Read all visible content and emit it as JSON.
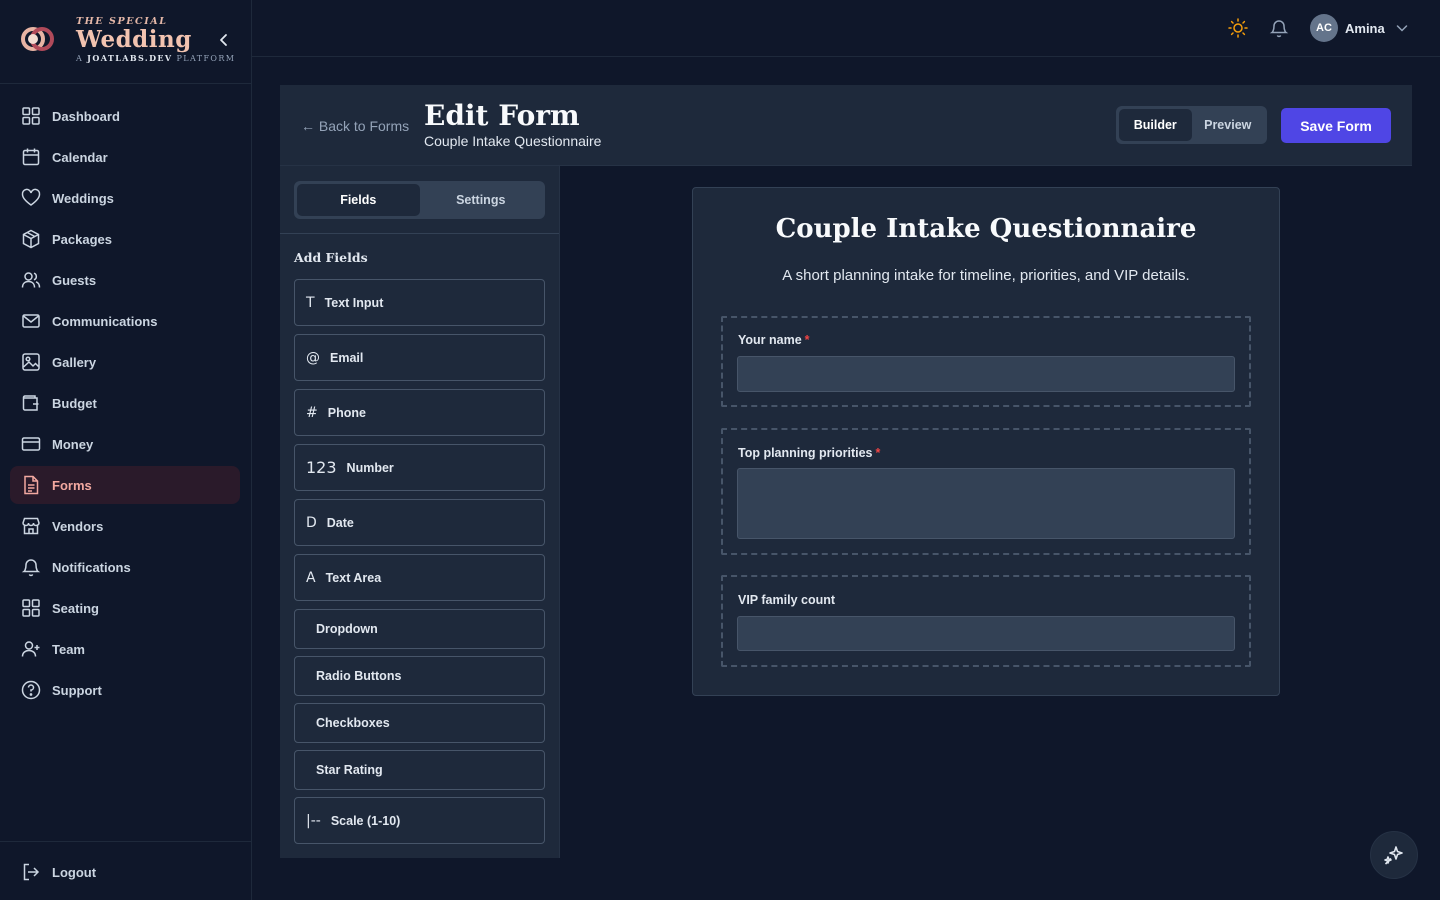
{
  "brand": {
    "tagline": "THE SPECIAL",
    "name": "Wedding",
    "sub_prefix": "A",
    "sub_brand": "JOATLABS.DEV",
    "sub_suffix": "PLATFORM"
  },
  "sidebar": {
    "items": [
      {
        "label": "Dashboard",
        "icon": "grid-icon"
      },
      {
        "label": "Calendar",
        "icon": "calendar-icon"
      },
      {
        "label": "Weddings",
        "icon": "heart-icon"
      },
      {
        "label": "Packages",
        "icon": "package-icon"
      },
      {
        "label": "Guests",
        "icon": "users-icon"
      },
      {
        "label": "Communications",
        "icon": "mail-icon"
      },
      {
        "label": "Gallery",
        "icon": "image-icon"
      },
      {
        "label": "Budget",
        "icon": "wallet-icon"
      },
      {
        "label": "Money",
        "icon": "credit-card-icon"
      },
      {
        "label": "Forms",
        "icon": "file-text-icon",
        "active": true
      },
      {
        "label": "Vendors",
        "icon": "store-icon"
      },
      {
        "label": "Notifications",
        "icon": "bell-icon"
      },
      {
        "label": "Seating",
        "icon": "grid-icon"
      },
      {
        "label": "Team",
        "icon": "user-plus-icon"
      },
      {
        "label": "Support",
        "icon": "help-circle-icon"
      }
    ],
    "logout_label": "Logout"
  },
  "topbar": {
    "user_initials": "AC",
    "user_name": "Amina"
  },
  "header": {
    "back_label": "← Back to Forms",
    "title": "Edit Form",
    "subtitle": "Couple Intake Questionnaire",
    "mode_tabs": [
      "Builder",
      "Preview"
    ],
    "active_mode": "Builder",
    "save_label": "Save Form"
  },
  "panel": {
    "tabs": [
      "Fields",
      "Settings"
    ],
    "active_tab": "Fields",
    "section_label": "Add Fields",
    "field_types": [
      {
        "icon": "T",
        "label": "Text Input"
      },
      {
        "icon": "@",
        "label": "Email"
      },
      {
        "icon": "#",
        "label": "Phone"
      },
      {
        "icon": "123",
        "label": "Number"
      },
      {
        "icon": "D",
        "label": "Date"
      },
      {
        "icon": "A",
        "label": "Text Area"
      },
      {
        "icon": "",
        "label": "Dropdown"
      },
      {
        "icon": "",
        "label": "Radio Buttons"
      },
      {
        "icon": "",
        "label": "Checkboxes"
      },
      {
        "icon": "",
        "label": "Star Rating"
      },
      {
        "icon": "|--",
        "label": "Scale (1-10)"
      }
    ]
  },
  "form": {
    "title": "Couple Intake Questionnaire",
    "description": "A short planning intake for timeline, priorities, and VIP details.",
    "questions": [
      {
        "label": "Your name",
        "required": true,
        "type": "text",
        "value": ""
      },
      {
        "label": "Top planning priorities",
        "required": true,
        "type": "textarea",
        "value": ""
      },
      {
        "label": "VIP family count",
        "required": false,
        "type": "number",
        "value": ""
      }
    ]
  },
  "colors": {
    "background": "#0f172a",
    "panel": "#1e293b",
    "accent": "#4f46e5",
    "brand": "#f2c3b0",
    "required": "#ef4444",
    "active_nav": "#f2a8a0"
  }
}
